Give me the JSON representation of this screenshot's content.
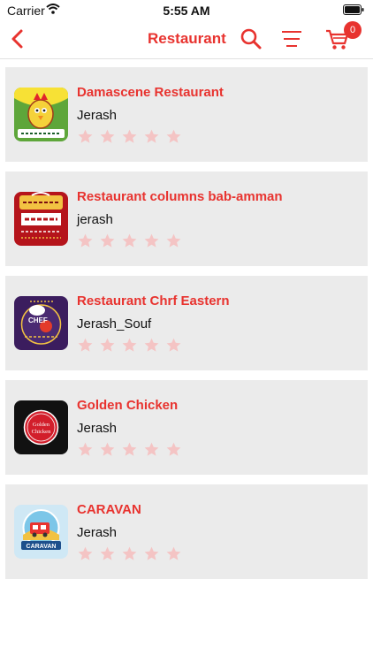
{
  "status_bar": {
    "carrier": "Carrier",
    "time": "5:55 AM"
  },
  "nav": {
    "title": "Restaurant",
    "cart_count": "0",
    "accent_color": "#e8332f"
  },
  "restaurants": [
    {
      "name": "Damascene Restaurant",
      "city": "Jerash",
      "rating": 0,
      "logo_icon": "chicken-logo-icon"
    },
    {
      "name": "Restaurant columns bab-amman",
      "city": "jerash",
      "rating": 0,
      "logo_icon": "arabic-sign-logo-icon"
    },
    {
      "name": "Restaurant Chrf Eastern",
      "city": "Jerash_Souf",
      "rating": 0,
      "logo_icon": "chef-logo-icon"
    },
    {
      "name": "Golden Chicken",
      "city": "Jerash",
      "rating": 0,
      "logo_icon": "golden-chicken-logo-icon"
    },
    {
      "name": "CARAVAN",
      "city": "Jerash",
      "rating": 0,
      "logo_icon": "caravan-logo-icon"
    }
  ],
  "logo_text": {
    "golden_1": "Golden",
    "golden_2": "Chicken",
    "caravan": "CARAVAN",
    "chef": "CHEF"
  },
  "star_color_empty": "#f4c4c4"
}
